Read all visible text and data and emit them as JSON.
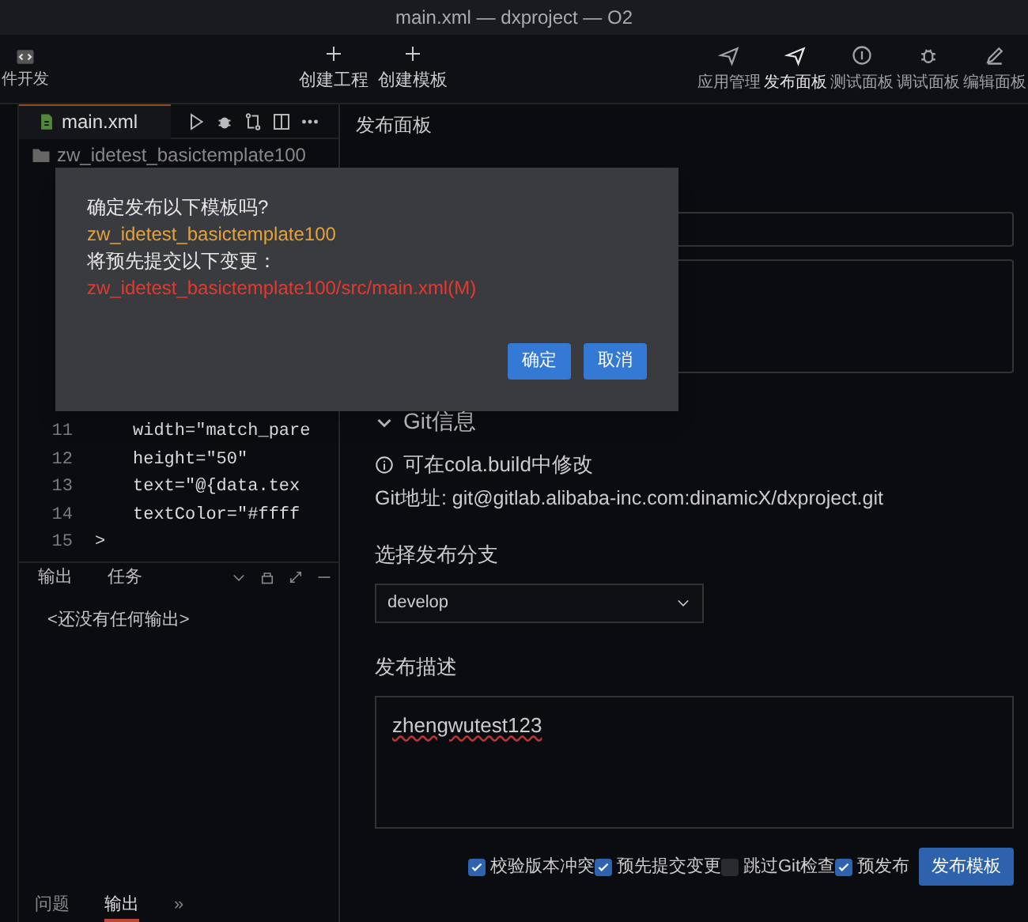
{
  "window": {
    "title": "main.xml — dxproject — O2"
  },
  "toolbar": {
    "left_item": {
      "label": "件开发"
    },
    "center_items": [
      {
        "label": "创建工程"
      },
      {
        "label": "创建模板"
      }
    ],
    "right_items": [
      {
        "label": "应用管理",
        "selected": false
      },
      {
        "label": "发布面板",
        "selected": true
      },
      {
        "label": "测试面板",
        "selected": false
      },
      {
        "label": "调试面板",
        "selected": false
      },
      {
        "label": "编辑面板",
        "selected": false
      }
    ]
  },
  "editor": {
    "tab": {
      "label": "main.xml",
      "selected": true
    },
    "breadcrumb": "zw_idetest_basictemplate100",
    "lines": [
      {
        "number": "11",
        "code": "width=\"match_pare"
      },
      {
        "number": "12",
        "code": "height=\"50\""
      },
      {
        "number": "13",
        "code": "text=\"@{data.tex"
      },
      {
        "number": "14",
        "code": "textColor=\"#ffff"
      },
      {
        "number": "15",
        "code": ">"
      }
    ]
  },
  "output_panel": {
    "tabs": [
      {
        "label": "输出"
      },
      {
        "label": "任务"
      }
    ],
    "message": "<还没有任何输出>"
  },
  "bottom_tabs": [
    {
      "label": "问题",
      "selected": false
    },
    {
      "label": "输出",
      "selected": true
    },
    {
      "label": "»",
      "selected": false
    }
  ],
  "publish_panel": {
    "title": "发布面板",
    "git_heading": "Git信息",
    "hint": "可在cola.build中修改",
    "git_address": "Git地址: git@gitlab.alibaba-inc.com:dinamicX/dxproject.git",
    "branch_label": "选择发布分支",
    "branch_value": "develop",
    "description_label": "发布描述",
    "description_value": "zhengwutest123",
    "options": [
      {
        "label": "校验版本冲突",
        "checked": true
      },
      {
        "label": "预先提交变更",
        "checked": true
      },
      {
        "label": "跳过Git检查",
        "checked": false
      },
      {
        "label": "预发布",
        "checked": true
      }
    ],
    "publish_button": "发布模板"
  },
  "dialog": {
    "lines": [
      {
        "text": "确定发布以下模板吗?",
        "kind": "plain"
      },
      {
        "text": "zw_idetest_basictemplate100",
        "kind": "template"
      },
      {
        "text": "将预先提交以下变更：",
        "kind": "plain"
      },
      {
        "text": "zw_idetest_basictemplate100/src/main.xml(M)",
        "kind": "change"
      }
    ],
    "buttons": [
      {
        "label": "确定"
      },
      {
        "label": "取消"
      }
    ]
  }
}
